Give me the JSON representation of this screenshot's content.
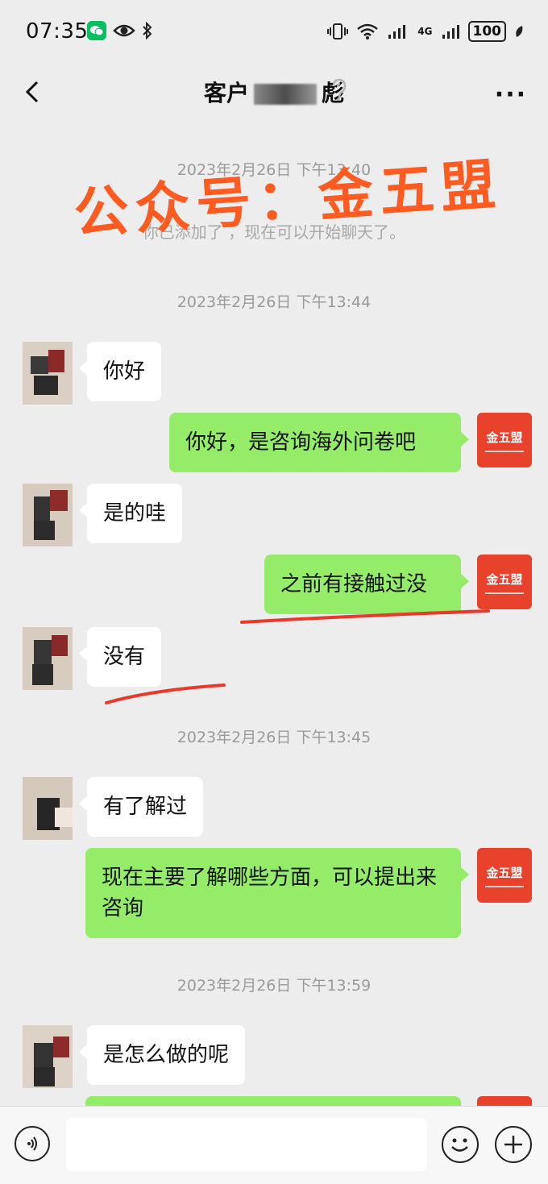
{
  "status": {
    "time": "07:35",
    "battery": "100",
    "network": "4G"
  },
  "nav": {
    "title_prefix": "客户",
    "title_suffix": "彪",
    "more": "···"
  },
  "watermark": "公众号：金五盟",
  "brand": {
    "label": "金五盟",
    "color": "#e8422d"
  },
  "chat": {
    "timestamps": [
      "2023年2月26日 下午13:40",
      "2023年2月26日 下午13:44",
      "2023年2月26日 下午13:45",
      "2023年2月26日 下午13:59"
    ],
    "system_notice": "你已添加了 ，现在可以开始聊天了。",
    "messages": [
      {
        "side": "in",
        "text": "你好"
      },
      {
        "side": "out",
        "text": "你好，是咨询海外问卷吧"
      },
      {
        "side": "in",
        "text": "是的哇"
      },
      {
        "side": "out",
        "text": "之前有接触过没"
      },
      {
        "side": "in",
        "text": "没有"
      },
      {
        "side": "in",
        "text": "有了解过"
      },
      {
        "side": "out",
        "text": "现在主要了解哪些方面，可以提出来咨询"
      },
      {
        "side": "in",
        "text": "是怎么做的呢"
      }
    ]
  },
  "input": {
    "placeholder": "",
    "value": ""
  },
  "colors": {
    "out_bubble": "#95ec69",
    "in_bubble": "#ffffff",
    "annotation": "#e8392a",
    "watermark": "#ff5a1f"
  }
}
